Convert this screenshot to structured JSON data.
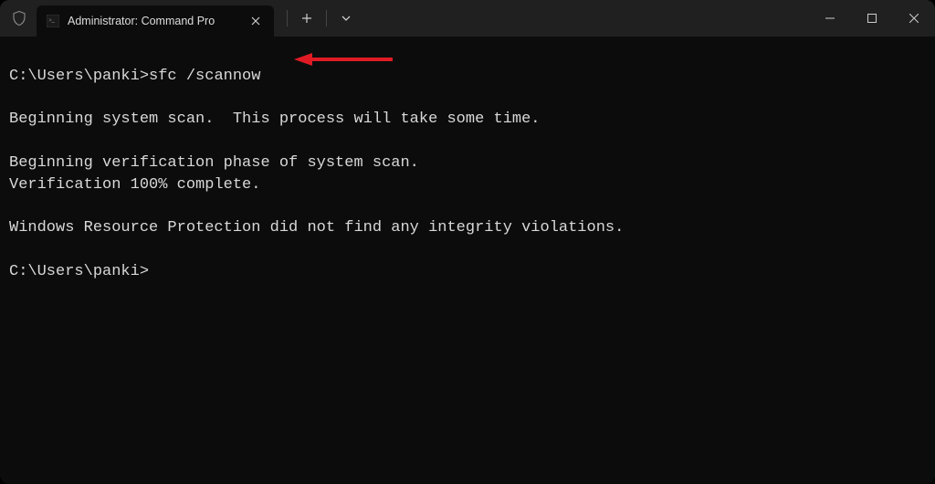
{
  "tab": {
    "title": "Administrator: Command Pro"
  },
  "terminal": {
    "prompt1": "C:\\Users\\panki>",
    "command": "sfc /scannow",
    "line1": "Beginning system scan.  This process will take some time.",
    "line2": "Beginning verification phase of system scan.",
    "line3": "Verification 100% complete.",
    "line4": "Windows Resource Protection did not find any integrity violations.",
    "prompt2": "C:\\Users\\panki>"
  },
  "annotation": {
    "color": "#e01b24"
  }
}
